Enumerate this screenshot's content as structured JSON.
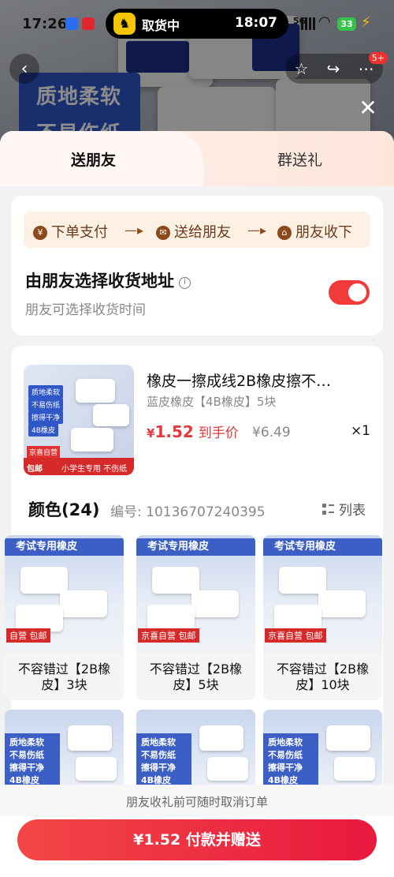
{
  "status_bar": {
    "time": "17:26",
    "island_label": "取货中",
    "island_time": "18:07",
    "network": "5G",
    "battery": "33"
  },
  "backdrop": {
    "promo_lines": [
      "质地柔软",
      "不易伤纸"
    ],
    "cart_badge": "5+"
  },
  "sheet": {
    "tabs": [
      {
        "label": "送朋友",
        "active": true
      },
      {
        "label": "群送礼",
        "active": false
      }
    ],
    "steps": [
      {
        "icon": "yen-icon",
        "label": "下单支付"
      },
      {
        "icon": "chat-icon",
        "label": "送给朋友"
      },
      {
        "icon": "gift-icon",
        "label": "朋友收下"
      }
    ],
    "address": {
      "title": "由朋友选择收货地址",
      "subtitle": "朋友可选择收货时间",
      "toggle_on": true
    },
    "product": {
      "title": "橡皮一擦成线2B橡皮擦不…",
      "spec": "蓝皮橡皮【4B橡皮】5块",
      "currency": "¥",
      "price": "1.52",
      "price_note": "到手价",
      "original_price": "¥6.49",
      "quantity": "×1",
      "thumb_tags": [
        "质地柔软",
        "不易伤纸",
        "擦得干净",
        "4B橡皮"
      ],
      "thumb_badge": "京喜自营",
      "thumb_strip": [
        "包邮",
        "小学生专用  不伤纸张"
      ]
    },
    "colors": {
      "heading": "颜色(24)",
      "code": "编号: 10136707240395",
      "list_label": "列表",
      "variants": [
        {
          "caption": "不容错过【2B橡皮】3块",
          "banner": "考试专用橡皮",
          "badge": "自营 包邮",
          "selected": false
        },
        {
          "caption": "不容错过【2B橡皮】5块",
          "banner": "考试专用橡皮",
          "badge": "京喜自营 包邮",
          "selected": false
        },
        {
          "caption": "不容错过【2B橡皮】10块",
          "banner": "考试专用橡皮",
          "badge": "京喜自营 包邮",
          "selected": false
        },
        {
          "caption": "",
          "banner": "质地柔软 不易伤纸 擦得干净 4B橡皮",
          "badge": "",
          "selected": false
        },
        {
          "caption": "",
          "banner": "质地柔软 不易伤纸 擦得干净 4B橡皮",
          "badge": "",
          "selected": true
        },
        {
          "caption": "",
          "banner": "质地柔软 不易伤纸 擦得干净 4B橡皮",
          "badge": "",
          "selected": false
        }
      ]
    },
    "footer": {
      "note": "朋友收礼前可随时取消订单",
      "pay_button": "¥1.52 付款并赠送"
    }
  },
  "colors_theme": {
    "accent": "#e4393c",
    "step_bg": "#fdf1e4",
    "toggle_on": "#f23a3a"
  }
}
